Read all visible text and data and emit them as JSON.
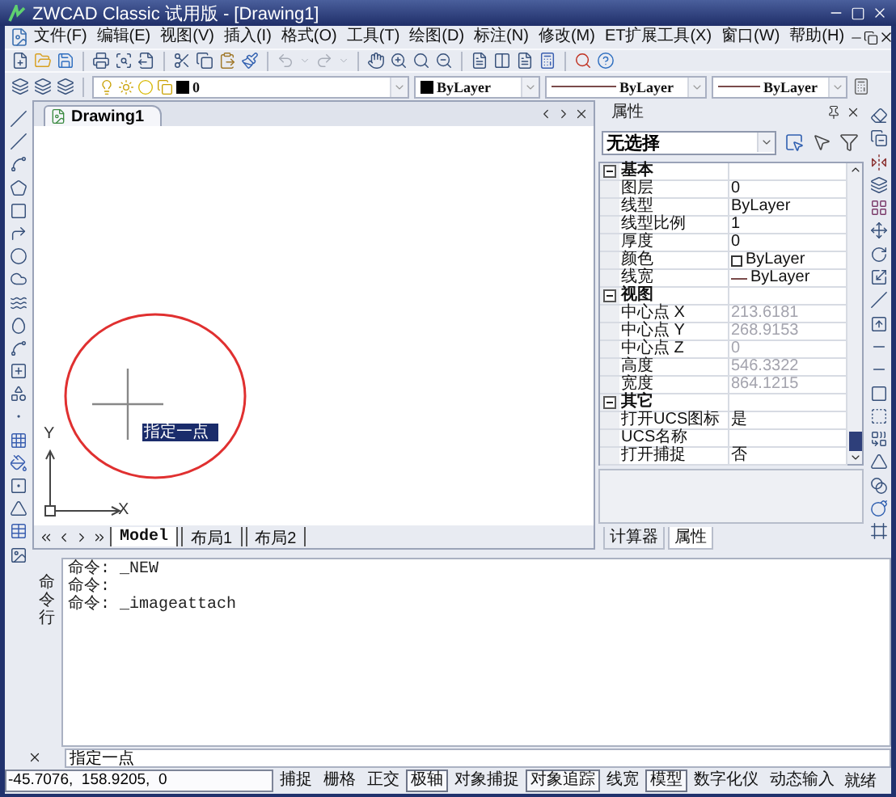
{
  "window": {
    "title": "ZWCAD Classic 试用版 - [Drawing1]"
  },
  "menu": [
    "文件(F)",
    "编辑(E)",
    "视图(V)",
    "插入(I)",
    "格式(O)",
    "工具(T)",
    "绘图(D)",
    "标注(N)",
    "修改(M)",
    "ET扩展工具(X)",
    "窗口(W)",
    "帮助(H)"
  ],
  "layer_toolbar": {
    "layer": "0",
    "object_colour": "ByLayer",
    "linetype": "ByLayer",
    "lineweight": "ByLayer"
  },
  "document_tab": {
    "title": "Drawing1"
  },
  "drawing": {
    "tooltip": "指定一点",
    "axis_x": "X",
    "axis_y": "Y"
  },
  "layout_tabs": [
    {
      "label": "Model",
      "selected": true
    },
    {
      "label": "布局1",
      "selected": false
    },
    {
      "label": "布局2",
      "selected": false
    }
  ],
  "properties": {
    "title": "属性",
    "selection": "无选择",
    "sections": [
      {
        "name": "基本",
        "expanded": true,
        "rows": [
          {
            "kind": "text",
            "name": "图层",
            "value": "0",
            "disabled": false
          },
          {
            "kind": "text",
            "name": "线型",
            "value": "ByLayer",
            "disabled": false
          },
          {
            "kind": "text",
            "name": "线型比例",
            "value": "1",
            "disabled": false
          },
          {
            "kind": "text",
            "name": "厚度",
            "value": "0",
            "disabled": false
          },
          {
            "kind": "color",
            "name": "颜色",
            "value": "ByLayer",
            "disabled": false
          },
          {
            "kind": "lineweight",
            "name": "线宽",
            "value": "ByLayer",
            "disabled": false
          }
        ]
      },
      {
        "name": "视图",
        "expanded": true,
        "rows": [
          {
            "kind": "text",
            "name": "中心点 X",
            "value": "213.6181",
            "disabled": true
          },
          {
            "kind": "text",
            "name": "中心点 Y",
            "value": "268.9153",
            "disabled": true
          },
          {
            "kind": "text",
            "name": "中心点 Z",
            "value": "0",
            "disabled": true
          },
          {
            "kind": "text",
            "name": "高度",
            "value": "546.3322",
            "disabled": true
          },
          {
            "kind": "text",
            "name": "宽度",
            "value": "864.1215",
            "disabled": true
          }
        ]
      },
      {
        "name": "其它",
        "expanded": true,
        "rows": [
          {
            "kind": "text",
            "name": "打开UCS图标",
            "value": "是",
            "disabled": false
          },
          {
            "kind": "text",
            "name": "UCS名称"
          },
          {
            "kind": "text",
            "name": "打开捕捉",
            "value": "否",
            "disabled": false
          }
        ]
      }
    ],
    "tabs": [
      {
        "label": "计算器",
        "selected": false
      },
      {
        "label": "属性",
        "selected": true
      }
    ]
  },
  "command": {
    "label": "命令行",
    "history": [
      "命令: _NEW",
      "命令:",
      "命令: _imageattach"
    ],
    "prompt": "指定一点"
  },
  "status_bar": {
    "coordinates": "-45.7076,  158.9205,  0",
    "toggles": [
      {
        "label": "捕捉",
        "on": false
      },
      {
        "label": "栅格",
        "on": false
      },
      {
        "label": "正交",
        "on": false
      },
      {
        "label": "极轴",
        "on": true
      },
      {
        "label": "对象捕捉",
        "on": false
      },
      {
        "label": "对象追踪",
        "on": true
      },
      {
        "label": "线宽",
        "on": false
      },
      {
        "label": "模型",
        "on": true
      },
      {
        "label": "数字化仪",
        "on": false
      },
      {
        "label": "动态输入",
        "on": false
      }
    ],
    "state": "就绪"
  }
}
